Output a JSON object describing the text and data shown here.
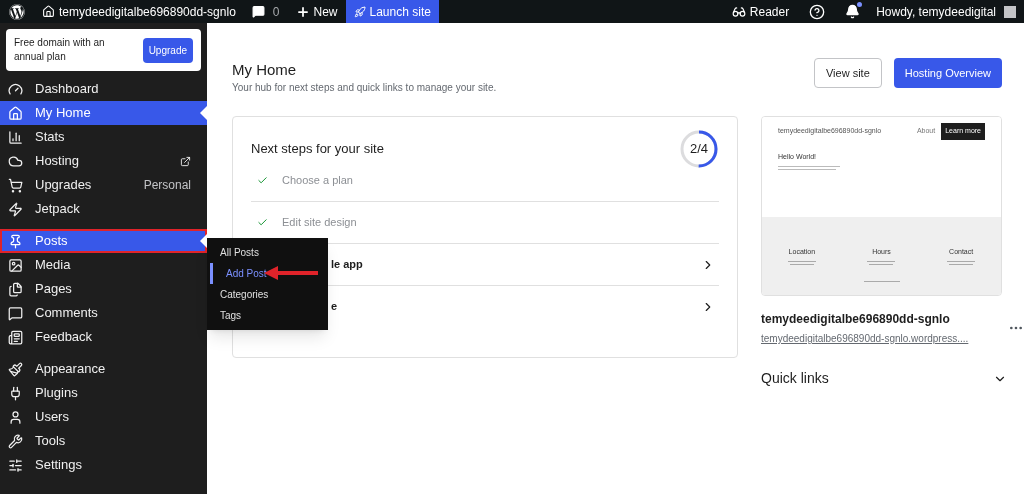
{
  "topbar": {
    "site": "temydeedigitalbe696890dd-sgnlo",
    "comments": "0",
    "new": "New",
    "launch": "Launch site",
    "reader": "Reader",
    "howdy": "Howdy, temydeedigital",
    "notifications_unread": true
  },
  "promo": {
    "text": "Free domain with an annual plan",
    "button": "Upgrade"
  },
  "sidebar": {
    "groups": [
      [
        {
          "label": "Dashboard",
          "selected": false
        },
        {
          "label": "My Home",
          "selected": true
        },
        {
          "label": "Stats",
          "selected": false
        },
        {
          "label": "Hosting",
          "selected": false,
          "external": true
        },
        {
          "label": "Upgrades",
          "selected": false,
          "badge": "Personal"
        },
        {
          "label": "Jetpack",
          "selected": false
        }
      ],
      [
        {
          "label": "Posts",
          "selected": true,
          "highlighted": true
        },
        {
          "label": "Media",
          "selected": false
        },
        {
          "label": "Pages",
          "selected": false
        },
        {
          "label": "Comments",
          "selected": false
        },
        {
          "label": "Feedback",
          "selected": false
        }
      ],
      [
        {
          "label": "Appearance",
          "selected": false
        },
        {
          "label": "Plugins",
          "selected": false
        },
        {
          "label": "Users",
          "selected": false
        },
        {
          "label": "Tools",
          "selected": false
        },
        {
          "label": "Settings",
          "selected": false
        }
      ]
    ]
  },
  "flyout": [
    {
      "label": "All Posts",
      "selected": false
    },
    {
      "label": "Add Post",
      "selected": true
    },
    {
      "label": "Categories",
      "selected": false
    },
    {
      "label": "Tags",
      "selected": false
    }
  ],
  "header": {
    "title": "My Home",
    "subtitle": "Your hub for next steps and quick links to manage your site.",
    "buttons": [
      {
        "label": "View site",
        "kind": "secondary"
      },
      {
        "label": "Hosting Overview",
        "kind": "primary"
      }
    ]
  },
  "steps_card": {
    "title": "Next steps for your site",
    "progress": "2/4",
    "steps": [
      {
        "label": "Choose a plan",
        "done": true
      },
      {
        "label": "Edit site design",
        "done": true
      },
      {
        "label": "le app",
        "done": false
      },
      {
        "label": "e",
        "done": false
      }
    ]
  },
  "site": {
    "preview": {
      "title": "temydeedigitalbe696890dd-sgnlo",
      "nav": "About",
      "cta": "Learn more",
      "heading": "Hello World!",
      "footer_columns": [
        "Location",
        "Hours",
        "Contact"
      ]
    },
    "name": "temydeedigitalbe696890dd-sgnlo",
    "url": "temydeedigitalbe696890dd-sgnlo.wordpress...."
  },
  "quick_links": {
    "title": "Quick links",
    "expanded": false
  }
}
